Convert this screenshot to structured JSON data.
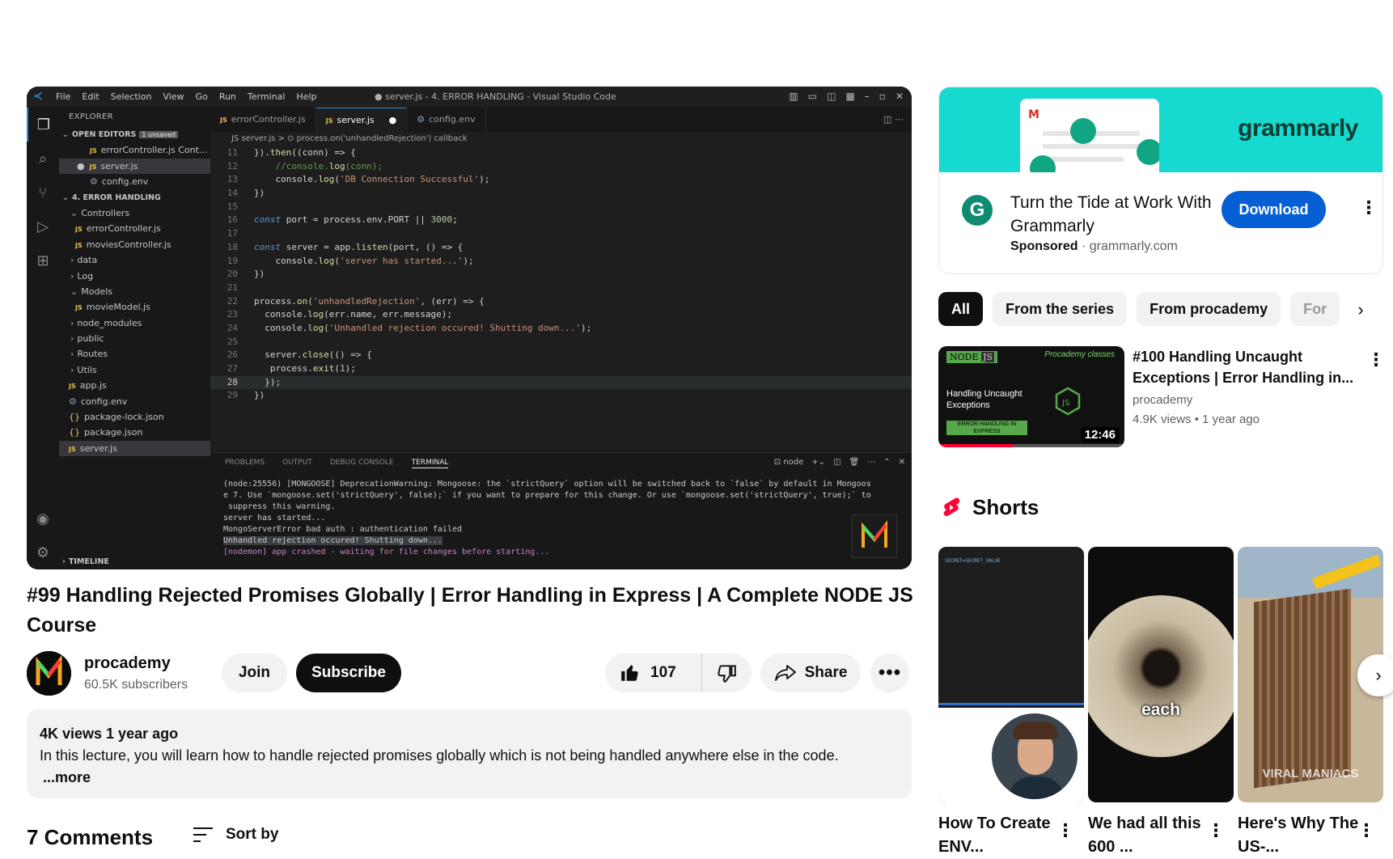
{
  "player": {
    "vscode": {
      "menu": [
        "File",
        "Edit",
        "Selection",
        "View",
        "Go",
        "Run",
        "Terminal",
        "Help"
      ],
      "window_title": "● server.js - 4. ERROR HANDLING - Visual Studio Code",
      "explorer_header": "EXPLORER",
      "open_editors_label": "OPEN EDITORS",
      "unsaved_badge": "1 unsaved",
      "open_editors": [
        "errorController.js  Control...",
        "server.js",
        "config.env"
      ],
      "project_label": "4. ERROR HANDLING",
      "tree": [
        "Controllers",
        "errorController.js",
        "moviesController.js",
        "data",
        "Log",
        "Models",
        "movieModel.js",
        "node_modules",
        "public",
        "Routes",
        "Utils",
        "app.js",
        "config.env",
        "package-lock.json",
        "package.json",
        "server.js"
      ],
      "timeline_label": "TIMELINE",
      "tabs": [
        "errorController.js",
        "server.js",
        "config.env"
      ],
      "breadcrumb": "JS server.js  >  ⊙ process.on('unhandledRejection') callback",
      "code_lines": [
        {
          "n": "11",
          "text": "}).then((conn) => {"
        },
        {
          "n": "12",
          "text": "    //console.log(conn);"
        },
        {
          "n": "13",
          "text": "    console.log('DB Connection Successful');"
        },
        {
          "n": "14",
          "text": "})"
        },
        {
          "n": "15",
          "text": ""
        },
        {
          "n": "16",
          "text": "const port = process.env.PORT || 3000;"
        },
        {
          "n": "17",
          "text": ""
        },
        {
          "n": "18",
          "text": "const server = app.listen(port, () => {"
        },
        {
          "n": "19",
          "text": "    console.log('server has started...');"
        },
        {
          "n": "20",
          "text": "})"
        },
        {
          "n": "21",
          "text": ""
        },
        {
          "n": "22",
          "text": "process.on('unhandledRejection', (err) => {"
        },
        {
          "n": "23",
          "text": "  console.log(err.name, err.message);"
        },
        {
          "n": "24",
          "text": "  console.log('Unhandled rejection occured! Shutting down...');"
        },
        {
          "n": "25",
          "text": ""
        },
        {
          "n": "26",
          "text": "  server.close(() => {"
        },
        {
          "n": "27",
          "text": "   process.exit(1);"
        },
        {
          "n": "28",
          "text": "  });"
        },
        {
          "n": "29",
          "text": "})"
        }
      ],
      "panel_tabs": [
        "PROBLEMS",
        "OUTPUT",
        "DEBUG CONSOLE",
        "TERMINAL"
      ],
      "panel_shell": "node",
      "terminal": [
        "(node:25556) [MONGOOSE] DeprecationWarning: Mongoose: the `strictQuery` option will be switched back to `false` by default in Mongoos",
        "e 7. Use `mongoose.set('strictQuery', false);` if you want to prepare for this change. Or use `mongoose.set('strictQuery', true);` to",
        " suppress this warning.",
        "server has started...",
        "MongoServerError bad auth : authentication failed",
        "Unhandled rejection occured! Shutting down...",
        "[nodemon] app crashed - waiting for file changes before starting..."
      ]
    }
  },
  "video": {
    "title": "#99 Handling Rejected Promises Globally | Error Handling in Express | A Complete NODE JS Course",
    "channel": "procademy",
    "subscribers": "60.5K subscribers",
    "join_label": "Join",
    "subscribe_label": "Subscribe",
    "likes": "107",
    "share_label": "Share",
    "description": {
      "stats": "4K views  1 year ago",
      "text": "In this lecture, you will learn how to handle rejected promises globally which is not being handled anywhere else in the code.",
      "more": "...more"
    },
    "comments_heading": "7 Comments",
    "sort_label": "Sort by"
  },
  "ad": {
    "wordmark": "grammarly",
    "title": "Turn the Tide at Work With Grammarly",
    "sponsored": "Sponsored",
    "domain": "grammarly.com",
    "button": "Download"
  },
  "chips": [
    "All",
    "From the series",
    "From procademy",
    "For"
  ],
  "recommendation": {
    "title": "#100 Handling Uncaught Exceptions | Error Handling in...",
    "channel": "procademy",
    "views": "4.9K views",
    "age": "1 year ago",
    "duration": "12:46",
    "watched_fraction": 0.4,
    "thumb_tag": "NODE",
    "thumb_tag_js": "JS",
    "thumb_brand": "Procademy classes",
    "thumb_text": "Handling Uncaught Exceptions",
    "thumb_bar_text": "ERROR HANDLING IN EXPRESS"
  },
  "shorts": {
    "heading": "Shorts",
    "items": [
      {
        "title": "How To Create ENV...",
        "overlay": "",
        "code_hint": "SECRET=SECRET_VALUE"
      },
      {
        "title": "We had all this 600 ...",
        "overlay": "each"
      },
      {
        "title": "Here's Why The US-...",
        "overlay": "VIRAL MANIACS"
      }
    ]
  },
  "colors": {
    "accent_blue": "#065fd4",
    "youtube_red": "#ff0033",
    "grammarly_teal": "#16d9cf",
    "vscode_bg": "#1e1e1e"
  }
}
